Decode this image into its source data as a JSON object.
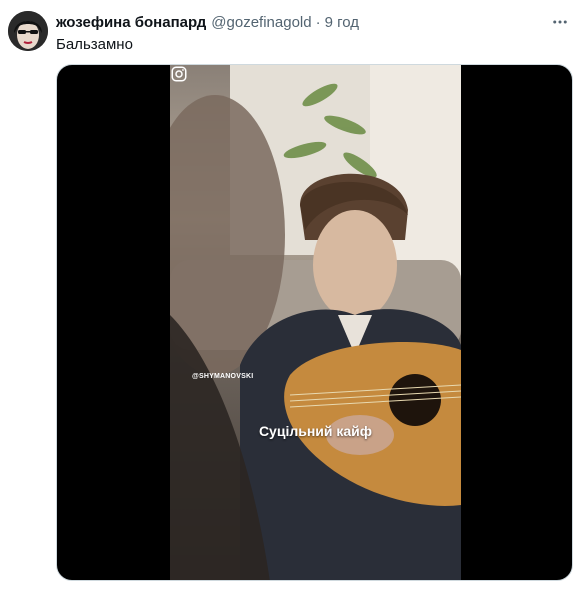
{
  "tweet": {
    "display_name": "жозефина бонапард",
    "handle": "@gozefinagold",
    "separator": "·",
    "time": "9 год",
    "text": "Бальзамно"
  },
  "video": {
    "watermark_handle": "@SHYMANOVSKI",
    "caption": "Суцільний кайф"
  },
  "icons": {
    "more": "more-horizontal-icon",
    "instagram": "instagram-icon"
  },
  "colors": {
    "text_primary": "#0f1419",
    "text_secondary": "#536471",
    "media_background": "#000000"
  }
}
